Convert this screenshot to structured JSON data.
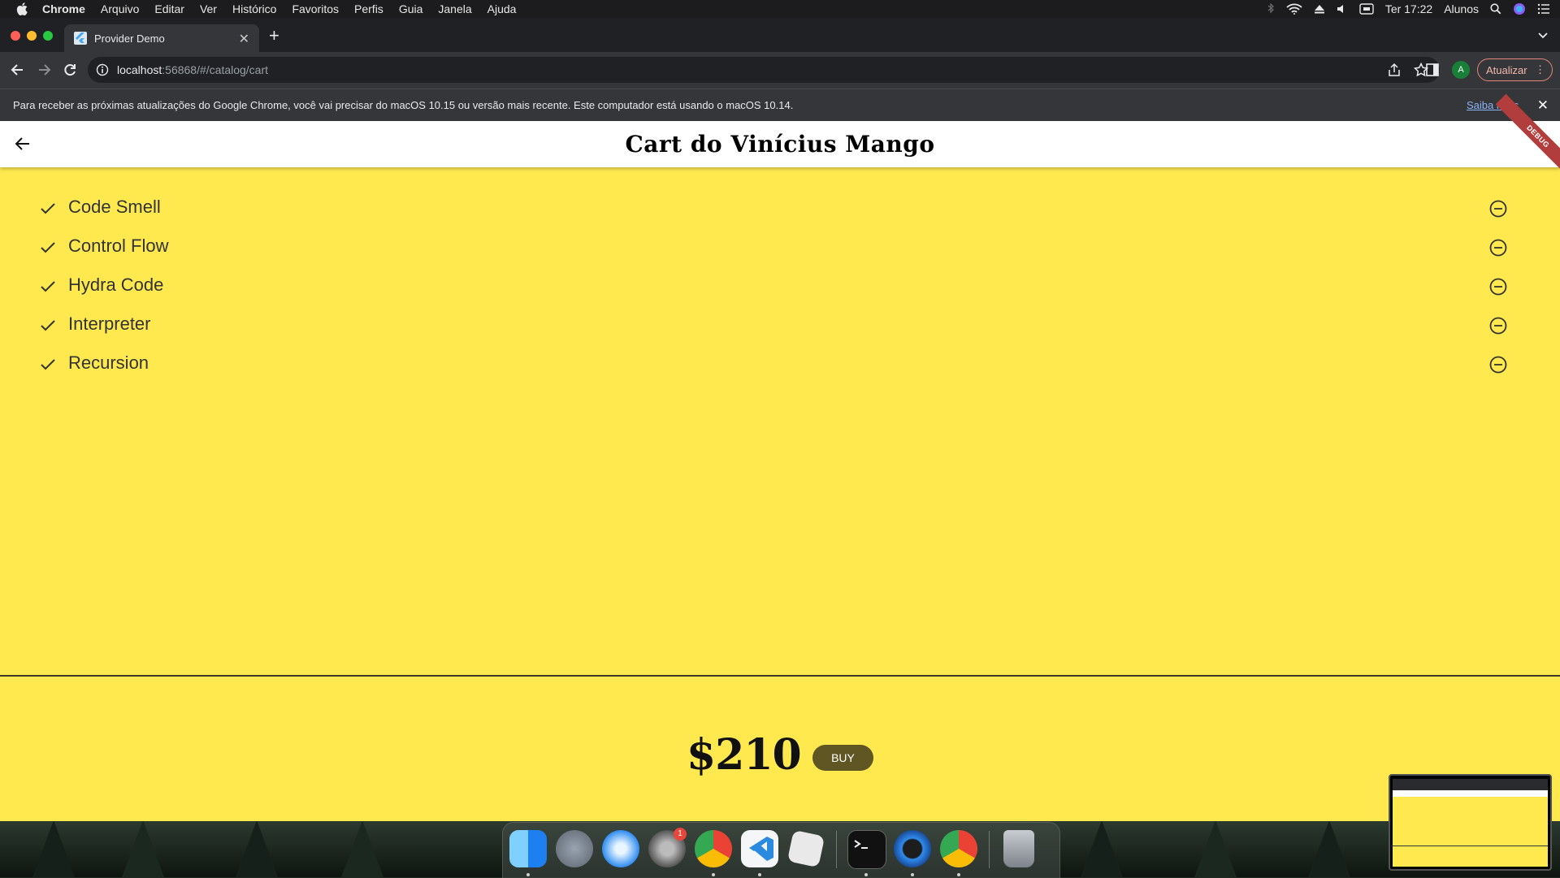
{
  "menubar": {
    "app": "Chrome",
    "items": [
      "Arquivo",
      "Editar",
      "Ver",
      "Histórico",
      "Favoritos",
      "Perfis",
      "Guia",
      "Janela",
      "Ajuda"
    ],
    "clock": "Ter 17:22",
    "user": "Alunos"
  },
  "browser": {
    "tab_title": "Provider Demo",
    "url_host": "localhost",
    "url_rest": ":56868/#/catalog/cart",
    "profile_initial": "A",
    "update_label": "Atualizar",
    "infobar_message": "Para receber as próximas atualizações do Google Chrome, você vai precisar do macOS 10.15 ou versão mais recente. Este computador está usando o macOS 10.14.",
    "infobar_link": "Saiba mais"
  },
  "app": {
    "title": "Cart do Vinícius Mango",
    "debug_banner": "DEBUG",
    "items": [
      {
        "label": "Code Smell"
      },
      {
        "label": "Control Flow"
      },
      {
        "label": "Hydra Code"
      },
      {
        "label": "Interpreter"
      },
      {
        "label": "Recursion"
      }
    ],
    "total": "$210",
    "buy_label": "BUY"
  },
  "dock": {
    "apps": [
      "finder",
      "launchpad",
      "safari",
      "system-preferences",
      "chrome",
      "vscode",
      "roblox",
      "terminal",
      "quicktime",
      "chrome",
      "trash"
    ],
    "system_prefs_badge": "1"
  },
  "colors": {
    "app_background": "#ffe94e",
    "buy_button": "#5f5623",
    "chrome_toolbar": "#35363a"
  }
}
